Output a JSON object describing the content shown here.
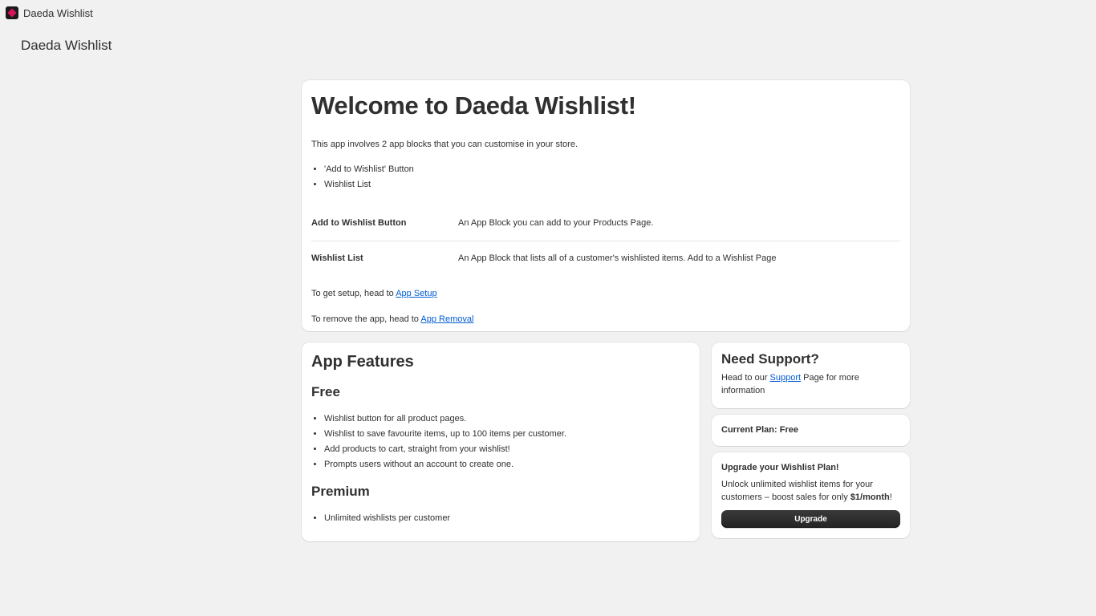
{
  "appbar": {
    "title": "Daeda Wishlist",
    "logo_icon": "app-logo-icon"
  },
  "page": {
    "title": "Daeda Wishlist"
  },
  "welcome": {
    "heading": "Welcome to Daeda Wishlist!",
    "intro": "This app involves 2 app blocks that you can customise in your store.",
    "blocks_list": [
      "'Add to Wishlist' Button",
      "Wishlist List"
    ],
    "rows": [
      {
        "name": "Add to Wishlist Button",
        "description": "An App Block you can add to your Products Page."
      },
      {
        "name": "Wishlist List",
        "description": "An App Block that lists all of a customer's wishlisted items. Add to a Wishlist Page"
      }
    ],
    "setup_prefix": "To get setup, head to",
    "setup_link": "App Setup",
    "remove_prefix": "To remove the app, head to",
    "remove_link": "App Removal"
  },
  "features": {
    "heading": "App Features",
    "free_heading": "Free",
    "free_items": [
      "Wishlist button for all product pages.",
      "Wishlist to save favourite items, up to 100 items per customer.",
      "Add products to cart, straight from your wishlist!",
      "Prompts users without an account to create one."
    ],
    "premium_heading": "Premium",
    "premium_items": [
      "Unlimited wishlists per customer"
    ]
  },
  "support": {
    "heading": "Need Support?",
    "text_prefix": "Head to our",
    "link": "Support",
    "text_suffix": "Page for more information"
  },
  "plan": {
    "label": "Current Plan: Free"
  },
  "upgrade": {
    "title": "Upgrade your Wishlist Plan!",
    "text_prefix": "Unlock unlimited wishlist items for your customers – boost sales for only",
    "price": "$1/month",
    "text_suffix": "!",
    "button": "Upgrade"
  },
  "colors": {
    "background": "#f1f1f1",
    "card": "#ffffff",
    "link": "#005bd3",
    "button": "#303030",
    "logo_accent": "#d4145a"
  }
}
